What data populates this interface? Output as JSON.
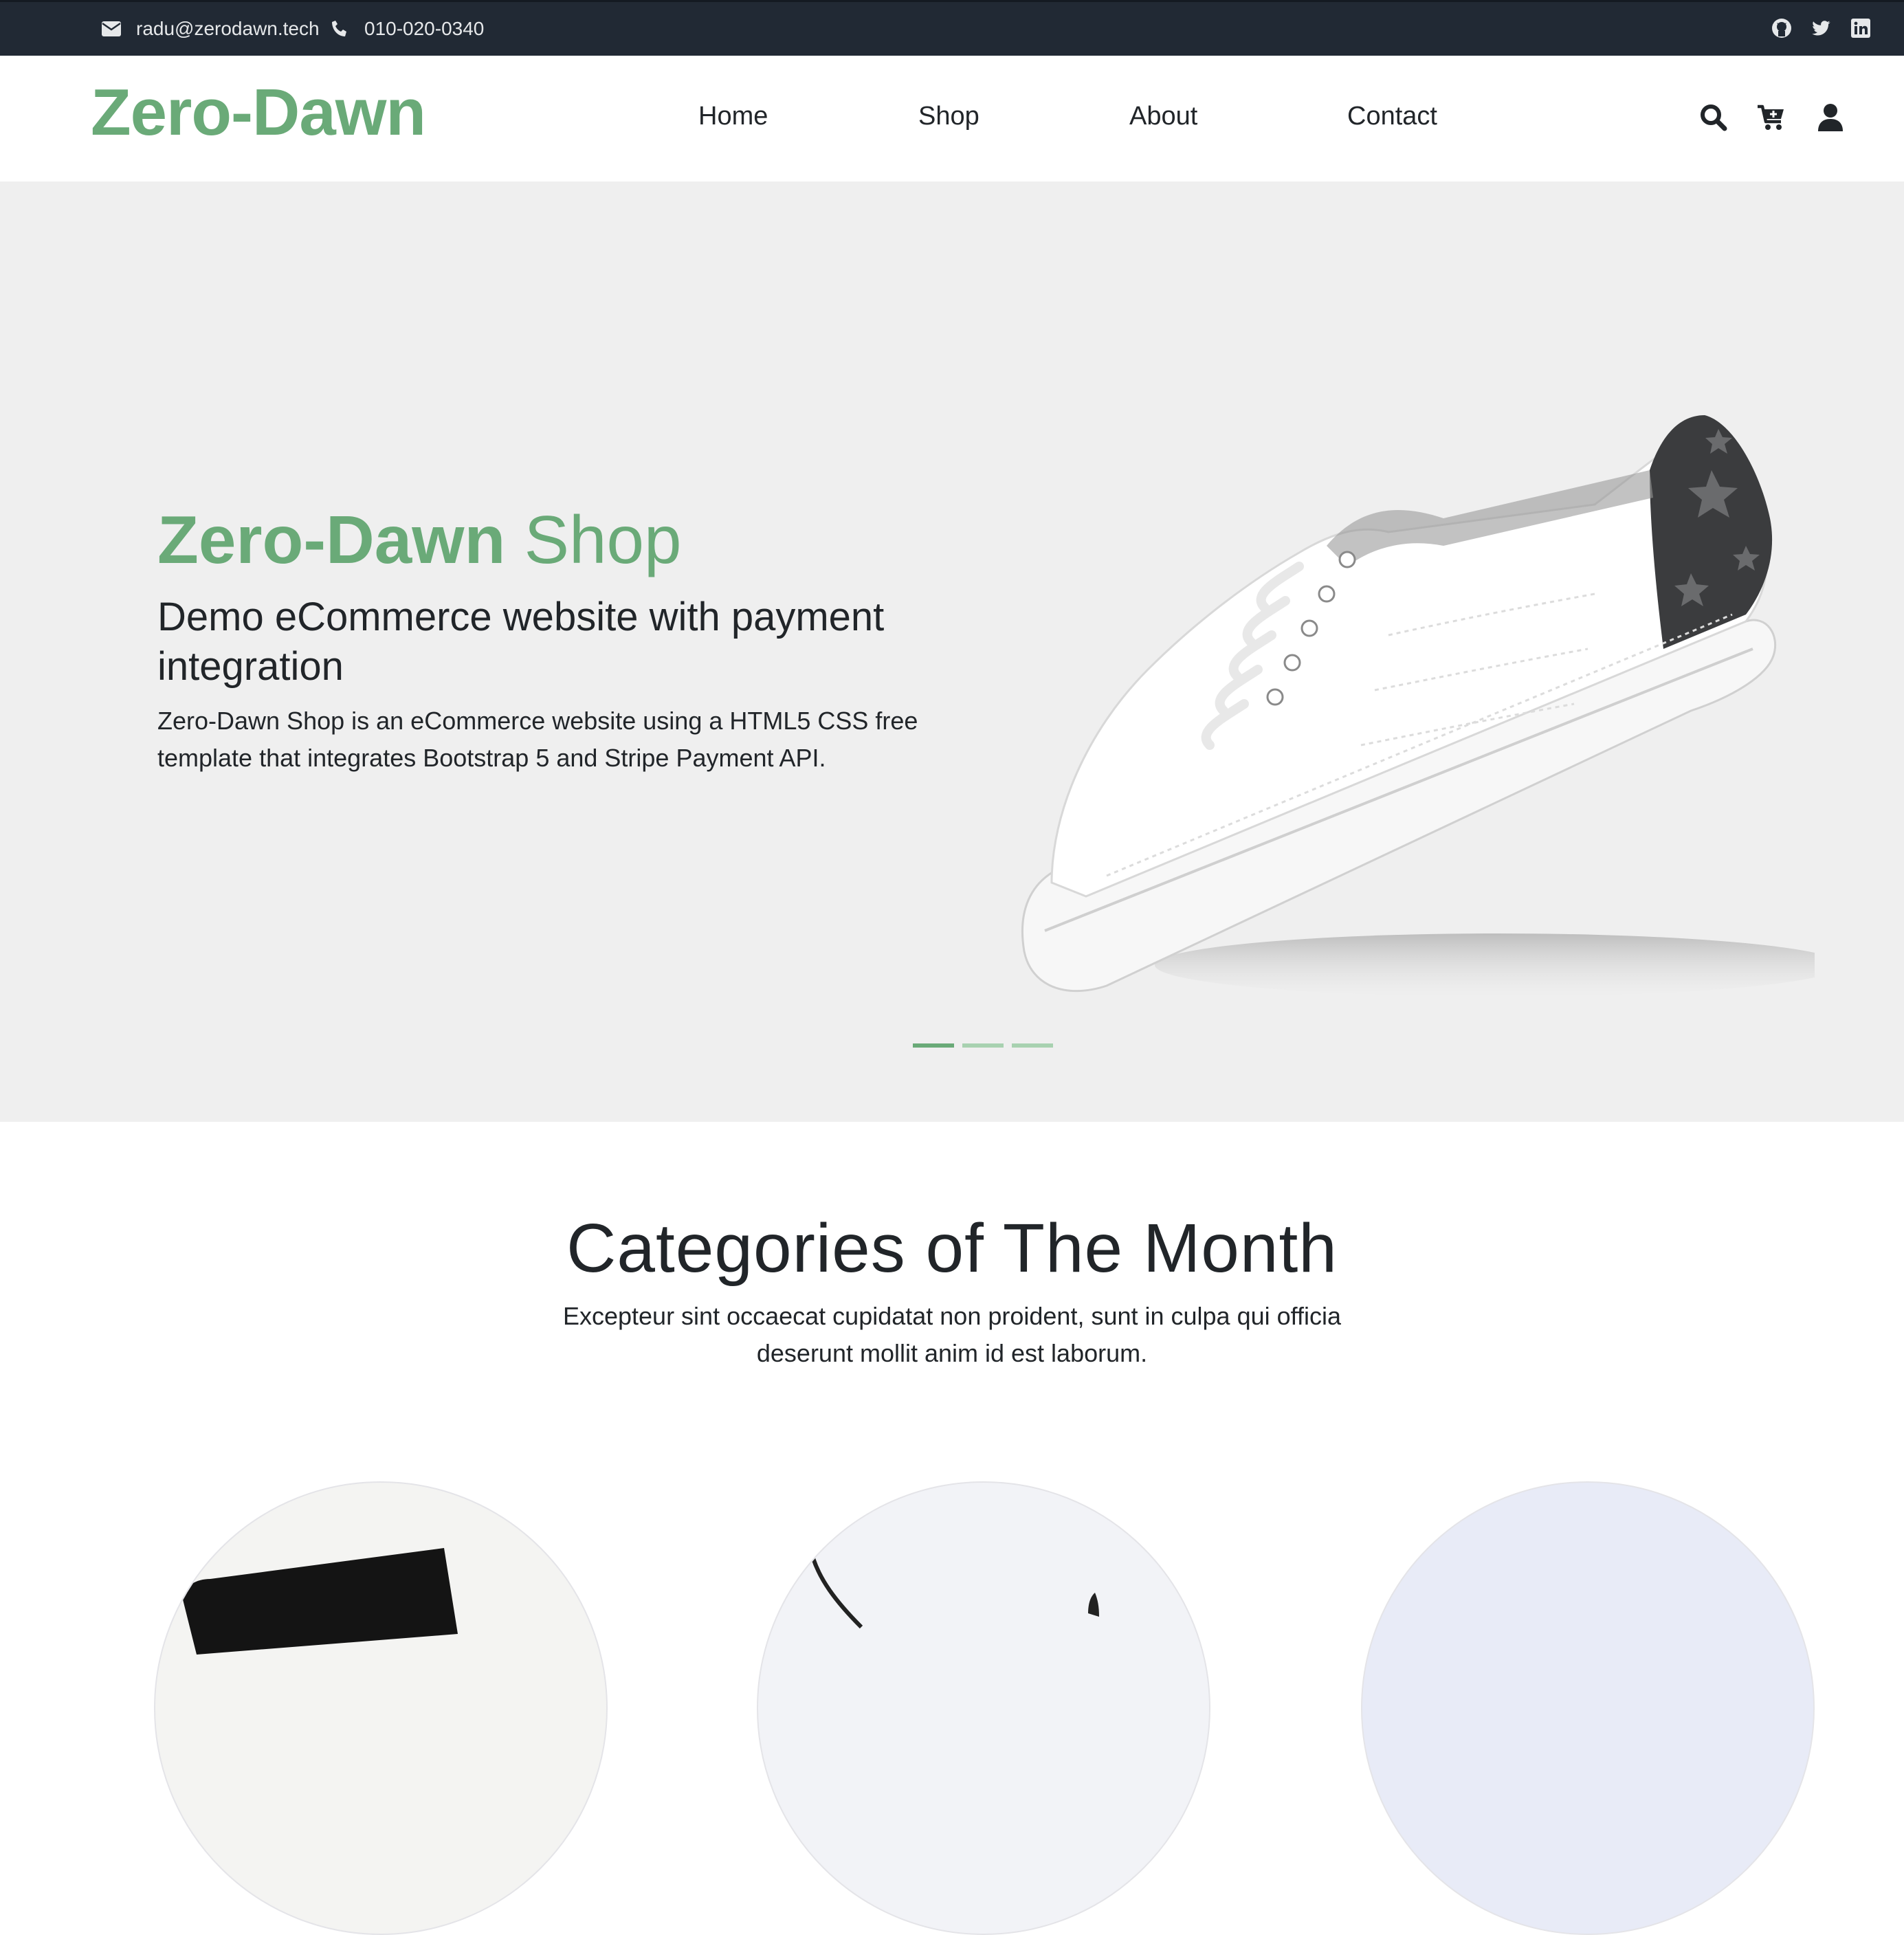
{
  "topbar": {
    "email": "radu@zerodawn.tech",
    "phone": "010-020-0340",
    "social": [
      "github-icon",
      "twitter-icon",
      "linkedin-icon"
    ]
  },
  "navbar": {
    "logo": "Zero-Dawn",
    "links": [
      "Home",
      "Shop",
      "About",
      "Contact"
    ],
    "icons": [
      "search-icon",
      "cart-icon",
      "user-icon"
    ]
  },
  "hero": {
    "title_bold": "Zero-Dawn",
    "title_light": "Shop",
    "subtitle": "Demo eCommerce website with payment integration",
    "description": "Zero-Dawn Shop is an eCommerce website using a HTML5 CSS free template that integrates Bootstrap 5 and Stripe Payment API.",
    "slides_total": 3,
    "active_slide": 1
  },
  "categories": {
    "title": "Categories of The Month",
    "description": "Excepteur sint occaecat cupidatat non proident, sunt in culpa qui officia deserunt mollit anim id est laborum."
  },
  "colors": {
    "brand_green": "#6aaa78",
    "topbar_bg": "#212934",
    "hero_bg": "#efefef",
    "text_dark": "#212529"
  }
}
